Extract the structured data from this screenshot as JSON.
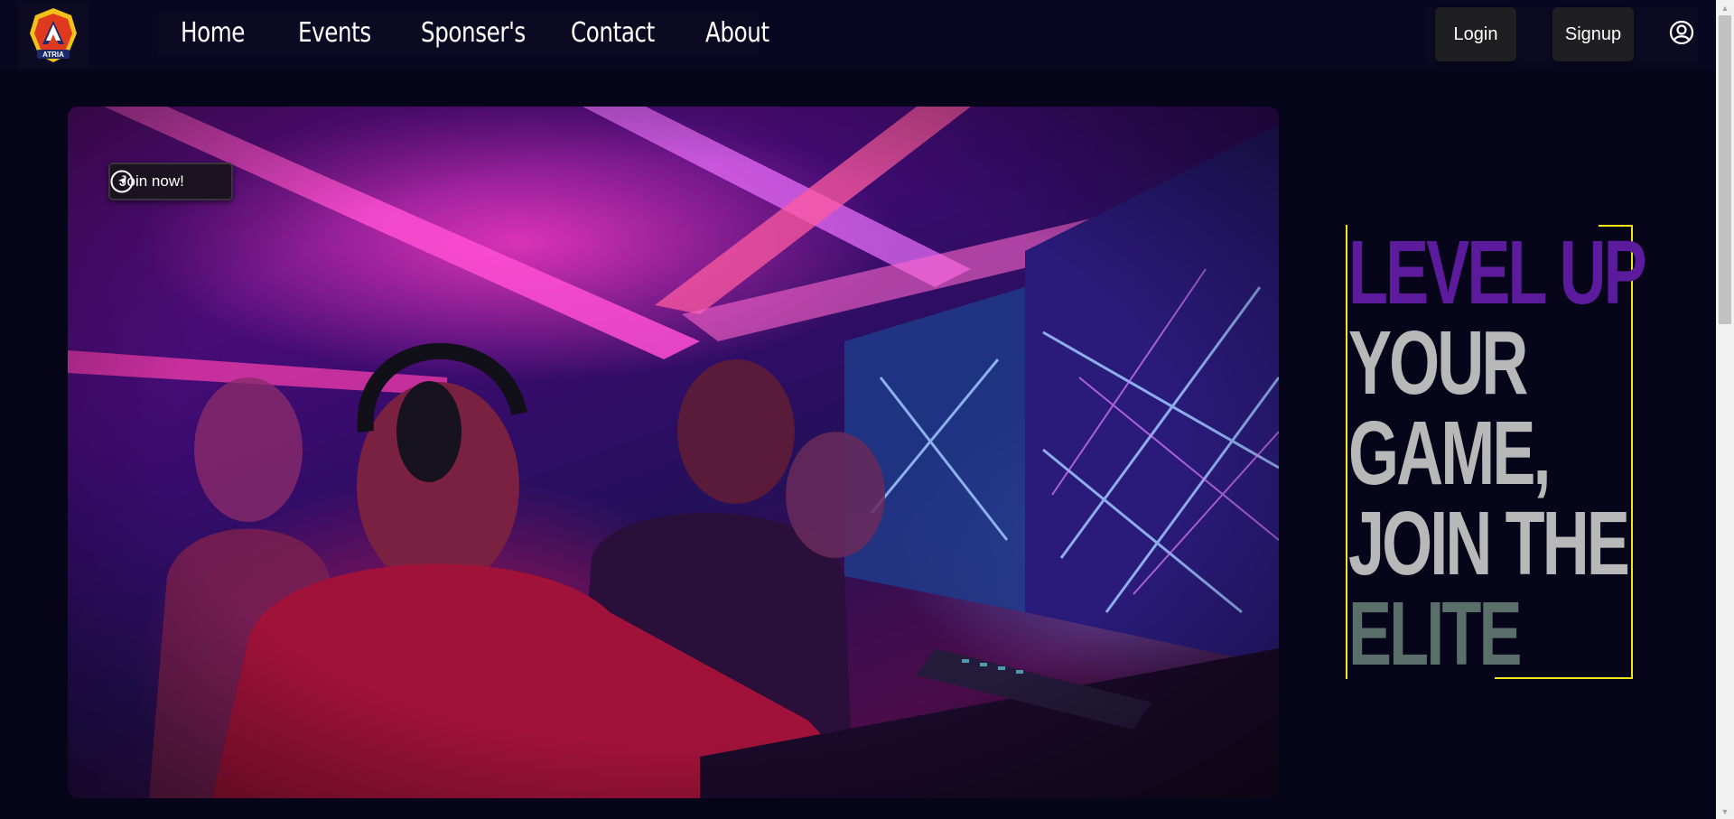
{
  "nav": {
    "links": [
      "Home",
      "Events",
      "Sponser's",
      "Contact",
      "About"
    ],
    "login_label": "Login",
    "signup_label": "Signup"
  },
  "hero": {
    "join_label": "Join now!"
  },
  "tagline": {
    "lines": [
      "LEVEL UP",
      "YOUR",
      "GAME,",
      "JOIN THE",
      "ELITE"
    ],
    "colors": [
      "#5c1a9c",
      "#b8b8b8",
      "#b8b8b8",
      "#b8b8b8",
      "#5a6e6a"
    ],
    "frame_color": "#f5e61a"
  },
  "icons": {
    "logo": "shield-logo-icon",
    "user": "user-circle-icon",
    "join": "navigation-arrow-icon"
  }
}
